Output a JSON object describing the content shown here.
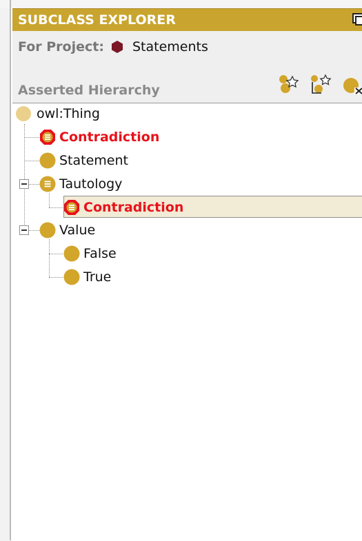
{
  "panel": {
    "title": "SUBCLASS EXPLORER",
    "project_label": "For Project:",
    "project_name": "Statements",
    "hierarchy_label": "Asserted Hierarchy",
    "accent_color": "#c9a52f"
  },
  "toolbar": {
    "icons": [
      "create-subclass-icon",
      "create-sibling-class-icon",
      "delete-class-icon"
    ]
  },
  "tree": {
    "root": "owl:Thing",
    "items": [
      {
        "label": "Contradiction",
        "style": "inconsistent"
      },
      {
        "label": "Statement",
        "style": "normal"
      },
      {
        "label": "Tautology",
        "style": "defined",
        "expanded": true
      },
      {
        "label": "Contradiction",
        "style": "inconsistent",
        "selected": true
      },
      {
        "label": "Value",
        "style": "normal",
        "expanded": true
      },
      {
        "label": "False",
        "style": "normal"
      },
      {
        "label": "True",
        "style": "normal"
      }
    ]
  }
}
